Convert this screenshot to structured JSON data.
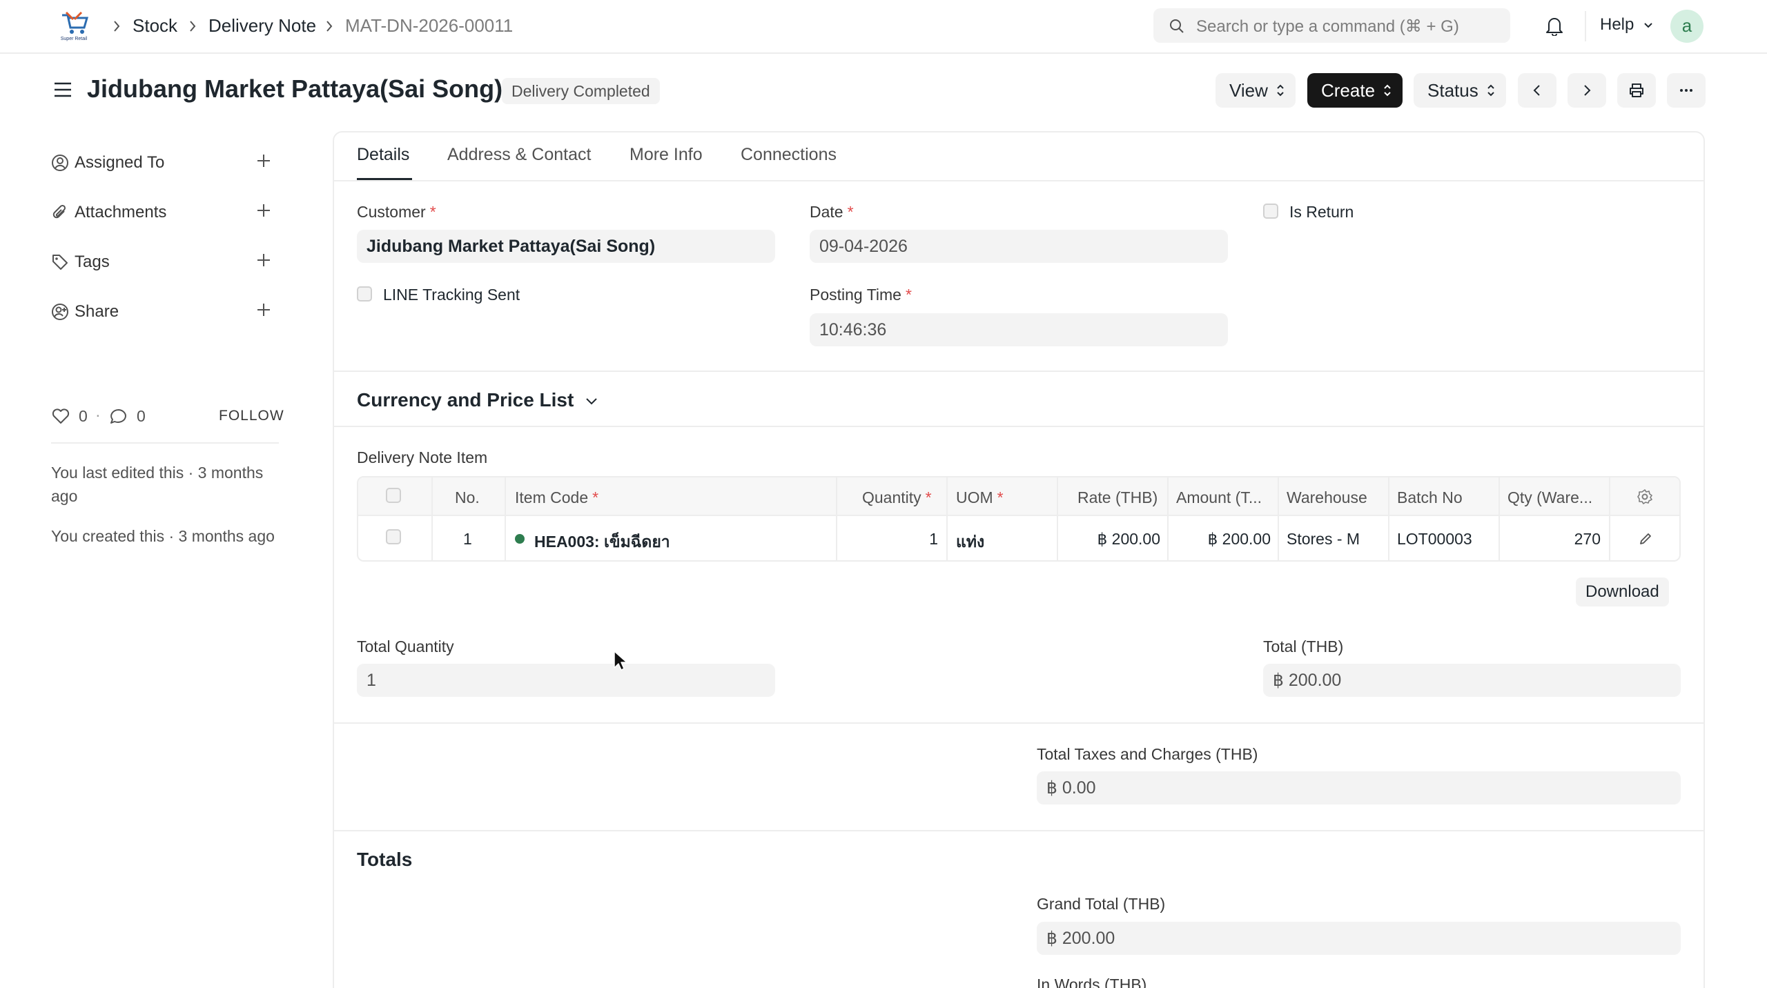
{
  "navbar": {
    "logo_text": "Super Retail",
    "breadcrumbs": [
      "Stock",
      "Delivery Note",
      "MAT-DN-2026-00011"
    ],
    "search_placeholder": "Search or type a command (⌘ + G)",
    "help_label": "Help",
    "avatar_initial": "a"
  },
  "page_head": {
    "title": "Jidubang Market Pattaya(Sai Song)",
    "status": "Delivery Completed",
    "view_label": "View",
    "create_label": "Create",
    "status_label": "Status"
  },
  "sidebar": {
    "items": [
      {
        "label": "Assigned To",
        "icon": "assign-icon"
      },
      {
        "label": "Attachments",
        "icon": "paperclip-icon"
      },
      {
        "label": "Tags",
        "icon": "tag-icon"
      },
      {
        "label": "Share",
        "icon": "share-icon"
      }
    ],
    "likes": "0",
    "comments": "0",
    "follow_label": "FOLLOW",
    "last_edited": "You last edited this · 3 months ago",
    "created": "You created this · 3 months ago"
  },
  "tabs": [
    "Details",
    "Address & Contact",
    "More Info",
    "Connections"
  ],
  "form": {
    "customer_label": "Customer",
    "customer_value": "Jidubang Market Pattaya(Sai Song)",
    "date_label": "Date",
    "date_value": "09-04-2026",
    "is_return_label": "Is Return",
    "line_tracking_label": "LINE Tracking Sent",
    "posting_time_label": "Posting Time",
    "posting_time_value": "10:46:36",
    "currency_section": "Currency and Price List",
    "items_label": "Delivery Note Item",
    "total_qty_label": "Total Quantity",
    "total_qty_value": "1",
    "total_label": "Total (THB)",
    "total_value": "฿ 200.00",
    "taxes_label": "Total Taxes and Charges (THB)",
    "taxes_value": "฿ 0.00",
    "totals_section": "Totals",
    "grand_total_label": "Grand Total (THB)",
    "grand_total_value": "฿ 200.00",
    "in_words_label": "In Words (THB)",
    "download_label": "Download"
  },
  "table": {
    "columns": [
      "No.",
      "Item Code",
      "Quantity",
      "UOM",
      "Rate (THB)",
      "Amount (T...",
      "Warehouse",
      "Batch No",
      "Qty (Ware..."
    ],
    "rows": [
      {
        "no": "1",
        "item_code": "HEA003: เข็มฉีดยา",
        "quantity": "1",
        "uom": "แท่ง",
        "rate": "฿ 200.00",
        "amount": "฿ 200.00",
        "warehouse": "Stores - M",
        "batch_no": "LOT00003",
        "qty_warehouse": "270"
      }
    ]
  },
  "colors": {
    "accent_dark": "#171717",
    "required": "#e24c4c",
    "status_dot": "#2e7d4f"
  }
}
